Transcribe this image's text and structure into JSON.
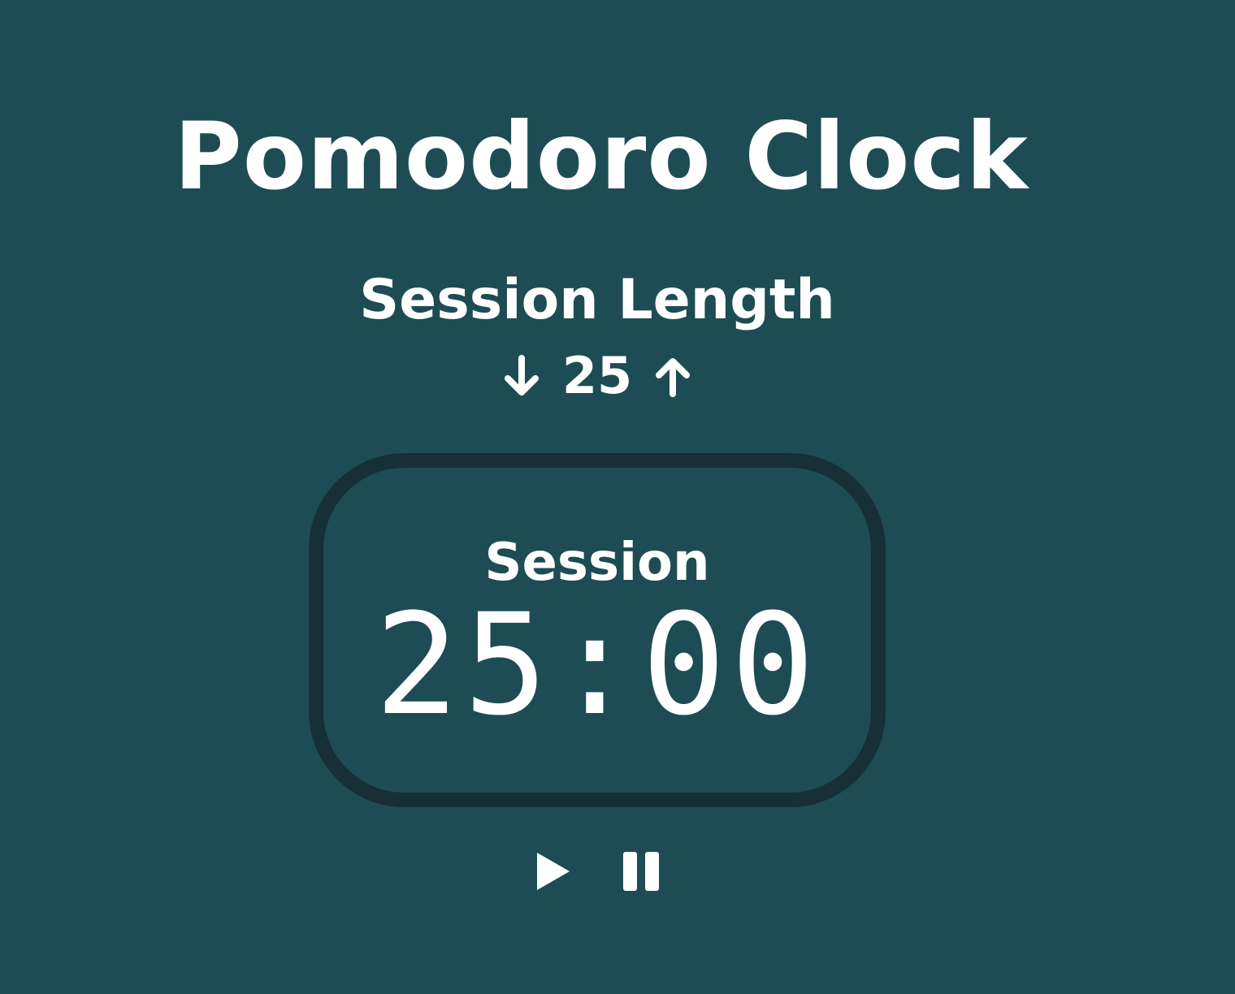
{
  "app": {
    "title": "Pomodoro Clock"
  },
  "session_length": {
    "label": "Session Length",
    "value": "25",
    "decrement_icon": "arrow-down-icon",
    "increment_icon": "arrow-up-icon"
  },
  "timer": {
    "label": "Session",
    "display": "25:00"
  },
  "controls": {
    "play_icon": "play-icon",
    "pause_icon": "pause-icon"
  },
  "colors": {
    "background": "#1e4c54",
    "timer_border": "#172f36",
    "text": "#ffffff"
  }
}
